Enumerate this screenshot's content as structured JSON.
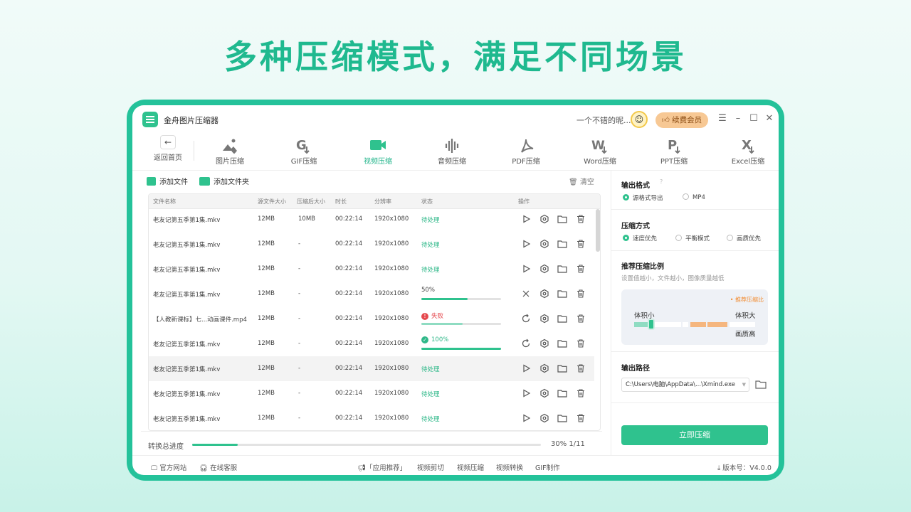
{
  "headline": "多种压缩模式，满足不同场景",
  "app": {
    "title": "金舟图片压缩器",
    "user_name": "一个不错的昵...",
    "vip_label": "续费会员"
  },
  "toolbar": {
    "back_label": "返回首页",
    "tools": [
      {
        "label": "图片压缩",
        "icon": "image-compress-icon",
        "active": false
      },
      {
        "label": "GIF压缩",
        "icon": "gif-compress-icon",
        "active": false
      },
      {
        "label": "视频压缩",
        "icon": "video-compress-icon",
        "active": true
      },
      {
        "label": "音频压缩",
        "icon": "audio-compress-icon",
        "active": false
      },
      {
        "label": "PDF压缩",
        "icon": "pdf-compress-icon",
        "active": false
      },
      {
        "label": "Word压缩",
        "icon": "word-compress-icon",
        "active": false
      },
      {
        "label": "PPT压缩",
        "icon": "ppt-compress-icon",
        "active": false
      },
      {
        "label": "Excel压缩",
        "icon": "excel-compress-icon",
        "active": false
      }
    ]
  },
  "files": {
    "add_file": "添加文件",
    "add_folder": "添加文件夹",
    "clear": "清空",
    "columns": [
      "文件名称",
      "源文件大小",
      "压缩后大小",
      "时长",
      "分辨率",
      "状态",
      "操作"
    ],
    "rows": [
      {
        "name": "老友记第五季第1集.mkv",
        "src": "12MB",
        "out": "-",
        "dur": "00:22:14",
        "res": "1920x1080",
        "status": "待处理",
        "kind": "pending",
        "lead": "play-icon"
      },
      {
        "name": "老友记第五季第1集.mkv",
        "src": "12MB",
        "out": "10MB",
        "dur": "00:22:14",
        "res": "1920x1080",
        "status": "待处理",
        "kind": "pending",
        "lead": "play-icon"
      },
      {
        "name": "老友记第五季第1集.mkv",
        "src": "12MB",
        "out": "-",
        "dur": "00:22:14",
        "res": "1920x1080",
        "status": "待处理",
        "kind": "pending",
        "lead": "play-icon"
      },
      {
        "name": "老友记第五季第1集.mkv",
        "src": "12MB",
        "out": "-",
        "dur": "00:22:14",
        "res": "1920x1080",
        "status": "待处理",
        "kind": "pending",
        "lead": "play-icon"
      },
      {
        "name": "老友记第五季第1集.mkv",
        "src": "12MB",
        "out": "-",
        "dur": "00:22:14",
        "res": "1920x1080",
        "status": "50%",
        "kind": "progress",
        "progress": 0.58,
        "lead": "cancel-icon"
      },
      {
        "name": "【人教新课标】七...动画课件.mp4",
        "src": "12MB",
        "out": "-",
        "dur": "00:22:14",
        "res": "1920x1080",
        "status": "失败",
        "kind": "failed",
        "progress": 0.52,
        "lead": "retry-icon"
      },
      {
        "name": "老友记第五季第1集.mkv",
        "src": "12MB",
        "out": "-",
        "dur": "00:22:14",
        "res": "1920x1080",
        "status": "100%",
        "kind": "done",
        "progress": 1.0,
        "lead": "retry-icon"
      },
      {
        "name": "老友记第五季第1集.mkv",
        "src": "12MB",
        "out": "-",
        "dur": "00:22:14",
        "res": "1920x1080",
        "status": "待处理",
        "kind": "pending",
        "lead": "play-icon",
        "selected": true
      },
      {
        "name": "老友记第五季第1集.mkv",
        "src": "12MB",
        "out": "-",
        "dur": "00:22:14",
        "res": "1920x1080",
        "status": "待处理",
        "kind": "pending",
        "lead": "play-icon"
      },
      {
        "name": "老友记第五季第1集.mkv",
        "src": "12MB",
        "out": "-",
        "dur": "00:22:14",
        "res": "1920x1080",
        "status": "待处理",
        "kind": "pending",
        "lead": "play-icon"
      }
    ]
  },
  "progress": {
    "label": "转换总进度",
    "value_text": "30% 1/11",
    "fraction": 0.13
  },
  "settings": {
    "format_title": "输出格式",
    "format_options": [
      "源格式导出",
      "MP4"
    ],
    "format_selected": 0,
    "mode_title": "压缩方式",
    "mode_options": [
      "速度优先",
      "平衡模式",
      "画质优先"
    ],
    "mode_selected": 0,
    "ratio_title": "推荐压缩比例",
    "ratio_hint": "设置值越小，文件越小，图像质量越低",
    "ratio_tag": "• 推荐压缩比",
    "ratio_small": "体积小",
    "ratio_large": "体积大",
    "ratio_quality": "画质高",
    "path_title": "输出路径",
    "path_value": "C:\\Users\\电脑\\AppData\\...\\Xmind.exe",
    "compress_button": "立即压缩"
  },
  "footer": {
    "website": "官方网站",
    "service": "在线客服",
    "recommend": "「应用推荐」",
    "links": [
      "视频剪切",
      "视频压缩",
      "视频转换",
      "GIF制作"
    ],
    "version": "版本号：V4.0.0"
  },
  "colors": {
    "accent": "#2fc28e",
    "headline": "#1fb98f",
    "frame": "#24c29a",
    "vip": "#f7c894",
    "fail": "#e5484d"
  }
}
